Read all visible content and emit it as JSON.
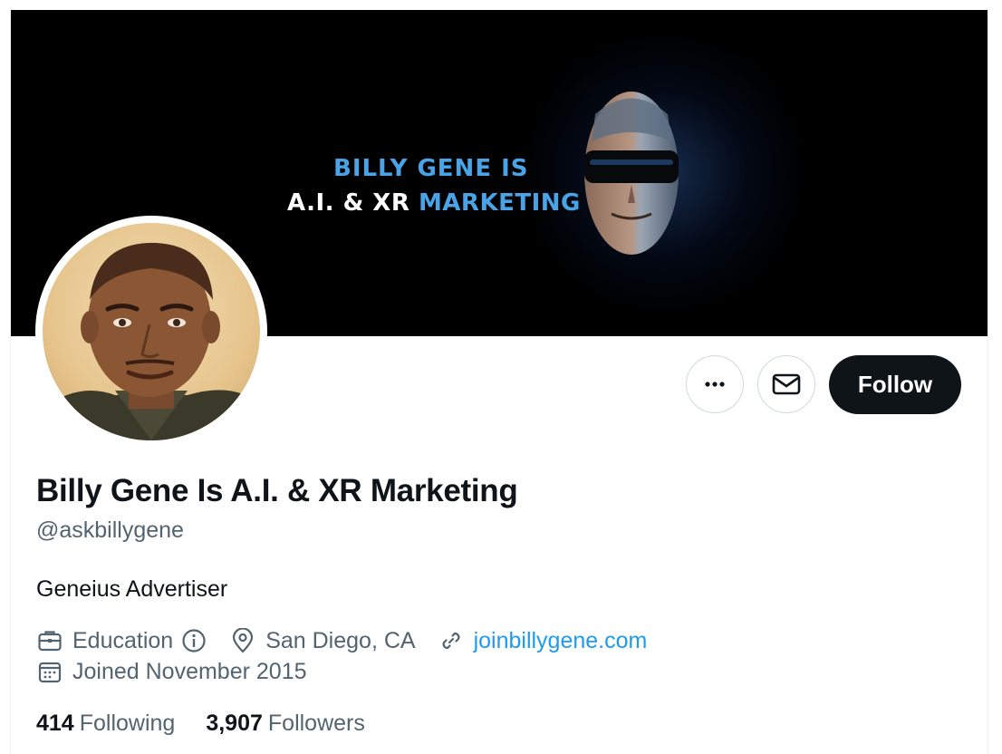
{
  "profile": {
    "display_name": "Billy Gene Is A.I. & XR Marketing",
    "handle": "@askbillygene",
    "bio": "Geneius Advertiser",
    "category": "Education",
    "location": "San Diego, CA",
    "website": "joinbillygene.com",
    "joined": "Joined November 2015"
  },
  "banner": {
    "line1": "BILLY GENE IS",
    "line2_white": "A.I. & XR ",
    "line2_accent": "MARKETING"
  },
  "actions": {
    "follow_label": "Follow"
  },
  "stats": {
    "following_count": "414",
    "following_label": "Following",
    "followers_count": "3,907",
    "followers_label": "Followers"
  },
  "icons": {
    "more": "more-horizontal-icon",
    "message": "envelope-icon",
    "category": "briefcase-icon",
    "info": "info-icon",
    "location": "location-pin-icon",
    "website": "link-icon",
    "joined": "calendar-icon"
  },
  "colors": {
    "text_primary": "#0f1419",
    "text_secondary": "#536471",
    "link": "#1d9bf0",
    "follow_bg": "#0f1419",
    "banner_accent": "#4aa3e6"
  }
}
